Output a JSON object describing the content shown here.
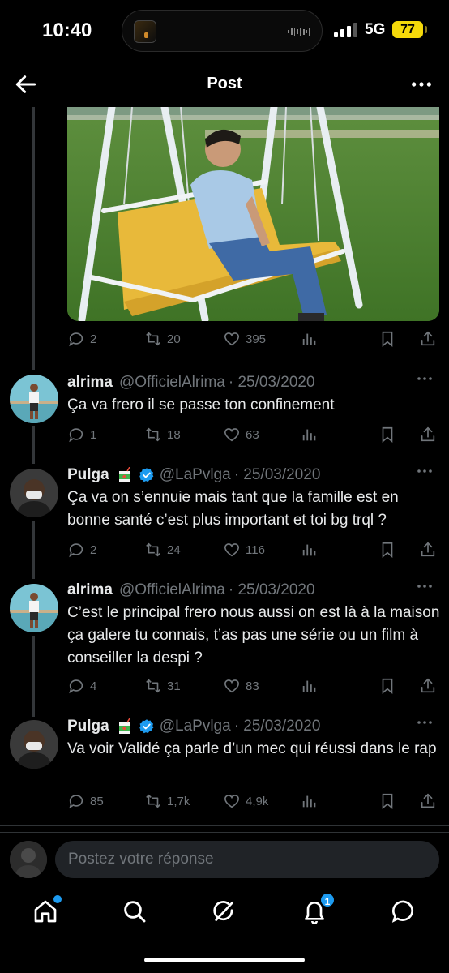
{
  "status_bar": {
    "time": "10:40",
    "network": "5G",
    "battery": "77",
    "signal_bars": 3
  },
  "header": {
    "title": "Post",
    "back_icon": "back-arrow-icon",
    "more_icon": "more-dots-icon"
  },
  "main_post": {
    "stats": {
      "replies": "2",
      "reposts": "20",
      "likes": "395"
    }
  },
  "replies": [
    {
      "name": "alrima",
      "handle": "@OfficielAlrima",
      "date": "· 25/03/2020",
      "verified": false,
      "text": "Ça va frero il se passe ton confinement",
      "stats": {
        "replies": "1",
        "reposts": "18",
        "likes": "63"
      }
    },
    {
      "name": "Pulga",
      "handle": "@LaPvlga",
      "date": "· 25/03/2020",
      "verified": true,
      "text": "Ça va on s’ennuie mais tant que la famille est en bonne santé c’est plus important et toi bg trql ?",
      "stats": {
        "replies": "2",
        "reposts": "24",
        "likes": "116"
      }
    },
    {
      "name": "alrima",
      "handle": "@OfficielAlrima",
      "date": "· 25/03/2020",
      "verified": false,
      "text": "C’est le principal frero nous aussi on est là à la maison ça galere tu connais, t’as pas une série ou un film à conseiller la despi ?",
      "stats": {
        "replies": "4",
        "reposts": "31",
        "likes": "83"
      }
    },
    {
      "name": "Pulga",
      "handle": "@LaPvlga",
      "date": "· 25/03/2020",
      "verified": true,
      "text": "Va voir Validé ça parle d’un mec qui réussi dans le rap",
      "stats": {
        "replies": "85",
        "reposts": "1,7k",
        "likes": "4,9k"
      }
    }
  ],
  "compose": {
    "placeholder": "Postez votre réponse"
  },
  "bottom_nav": {
    "items": [
      "home-icon",
      "search-icon",
      "grok-icon",
      "notifications-icon",
      "messages-icon"
    ],
    "notifications_badge": "1"
  },
  "colors": {
    "background": "#000000",
    "text": "#e7e9ea",
    "muted": "#71767b",
    "accent": "#1d9bf0",
    "battery": "#f5d90a"
  }
}
